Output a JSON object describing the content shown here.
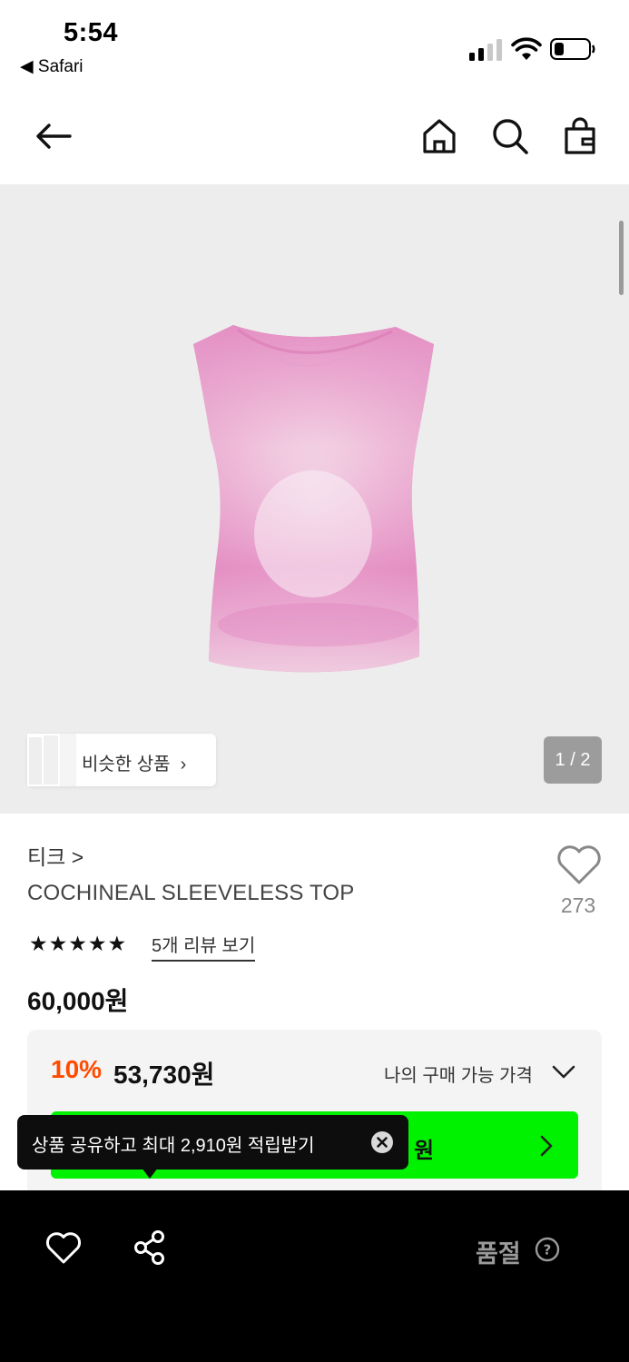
{
  "status_bar": {
    "time": "5:54",
    "back_app": "◀ Safari"
  },
  "nav": {
    "back_icon": "arrow-left-icon",
    "home_icon": "home-icon",
    "search_icon": "search-icon",
    "cart_icon": "shopping-bag-icon"
  },
  "gallery": {
    "similar_label": "비슷한 상품",
    "page_indicator": "1 / 2",
    "current_page": 1,
    "total_pages": 2,
    "product_color": "#e88cc8"
  },
  "product": {
    "brand": "티크 >",
    "name": "COCHINEAL SLEEVELESS TOP",
    "wish_count": "273",
    "rating_stars": "★★★★★",
    "rating_value": 5,
    "review_link": "5개 리뷰 보기",
    "price": "60,000원"
  },
  "discount": {
    "rate": "10%",
    "price": "53,730원",
    "my_price_label": "나의 구매 가능 가격",
    "button_text": "원",
    "accent_color": "#ff4b00",
    "button_color": "#00f200"
  },
  "tooltip": {
    "text": "상품 공유하고 최대 2,910원 적립받기"
  },
  "bottom_bar": {
    "soldout_label": "품절"
  }
}
